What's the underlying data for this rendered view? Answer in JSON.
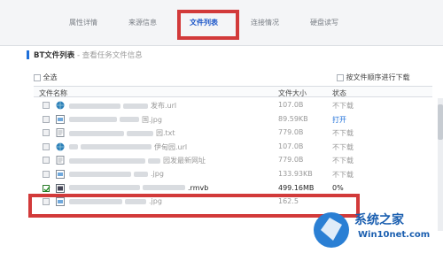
{
  "tabs": [
    "属性详情",
    "来源信息",
    "文件列表",
    "连接情况",
    "硬盘读写"
  ],
  "section": {
    "title": "BT文件列表",
    "subtitle": " - 查看任务文件信息"
  },
  "select_all_label": "全选",
  "order_label": "按文件顺序进行下载",
  "columns": {
    "name": "文件名称",
    "size": "文件大小",
    "status": "状态"
  },
  "rows": [
    {
      "name": "发布.url",
      "size": "107.0B",
      "status": "不下载",
      "icon": "globe-icon"
    },
    {
      "name": "国.jpg",
      "size": "89.59KB",
      "status": "打开",
      "icon": "image-icon"
    },
    {
      "name": "园.txt",
      "size": "779.0B",
      "status": "不下载",
      "icon": "text-file-icon"
    },
    {
      "name": "伊甸园.url",
      "size": "107.0B",
      "status": "不下载",
      "icon": "globe-icon"
    },
    {
      "name": "园发最新网址",
      "size": "779.0B",
      "status": "不下载",
      "icon": "text-file-icon"
    },
    {
      "name": ".jpg",
      "size": "133.93KB",
      "status": "不下载",
      "icon": "image-icon"
    },
    {
      "name": ".rmvb",
      "size": "499.16MB",
      "status": "0%",
      "icon": "video-file-icon",
      "checked": true
    },
    {
      "name": ".jpg",
      "size": "162.5",
      "status": "",
      "icon": "image-icon"
    }
  ],
  "watermark": {
    "line1": "系统之家",
    "line2": "Win10net.com"
  }
}
